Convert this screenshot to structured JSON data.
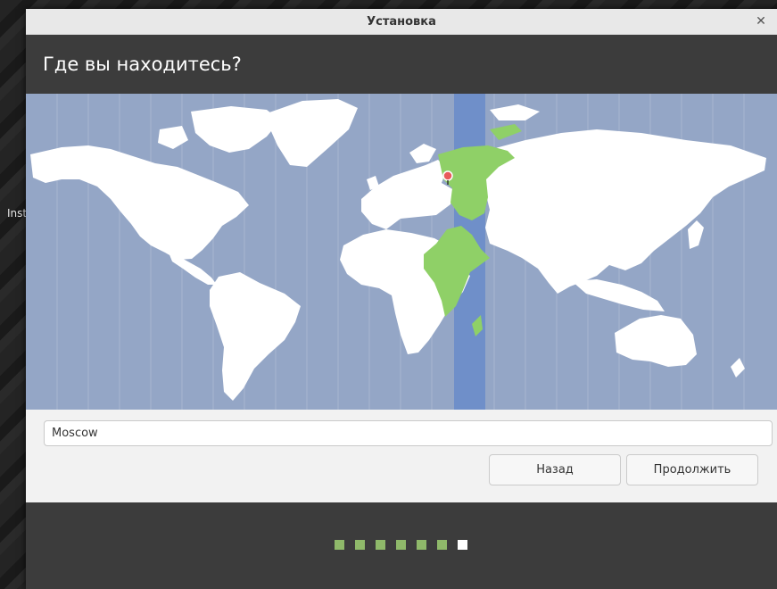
{
  "desktop": {
    "label": "Inst"
  },
  "window": {
    "title": "Установка"
  },
  "header": {
    "title": "Где вы находитесь?"
  },
  "location": {
    "value": "Moscow"
  },
  "buttons": {
    "back": "Назад",
    "continue": "Продолжить"
  },
  "progress": {
    "total_steps": 7,
    "current_step": 7
  },
  "colors": {
    "ocean": "#94a6c6",
    "land": "#ffffff",
    "selected_zone": "#6f8fc9",
    "selected_land": "#8fd067",
    "header_bg": "#3c3c3c",
    "step_done": "#8fb96a",
    "step_current": "#ffffff"
  }
}
